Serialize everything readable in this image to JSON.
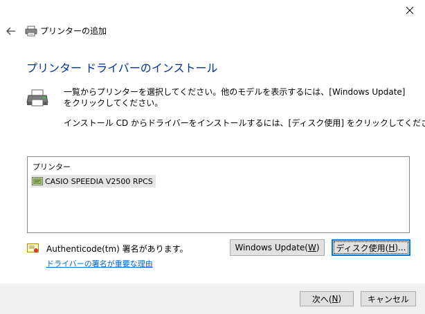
{
  "window": {
    "title": "プリンターの追加"
  },
  "heading": "プリンター ドライバーのインストール",
  "description": {
    "line1": "一覧からプリンターを選択してください。他のモデルを表示するには、[Windows Update] をクリックしてください。",
    "line2": "インストール CD からドライバーをインストールするには、[ディスク使用] をクリックしてください。"
  },
  "printer_list": {
    "header": "プリンター",
    "items": [
      {
        "label": "CASIO SPEEDIA V2500 RPCS",
        "selected": true
      }
    ]
  },
  "authenticode": {
    "text": "Authenticode(tm) 署名があります。",
    "link": "ドライバーの署名が重要な理由"
  },
  "buttons": {
    "windows_update": {
      "prefix": "Windows Update(",
      "accel": "W",
      "suffix": ")"
    },
    "disk": {
      "prefix": "ディスク使用(",
      "accel": "H",
      "suffix": ")..."
    },
    "next": {
      "prefix": "次へ(",
      "accel": "N",
      "suffix": ")"
    },
    "cancel": "キャンセル"
  },
  "icons": {
    "close": "close-icon",
    "back": "back-arrow-icon",
    "title_printer": "printer-icon",
    "large_printer": "printer-icon",
    "list_item": "printer-driver-icon",
    "certificate": "certificate-icon"
  },
  "colors": {
    "heading": "#003399",
    "link": "#0066cc",
    "focus_border": "#0078d7",
    "footer_bg": "#f0f0f0",
    "button_bg": "#e1e1e1",
    "selected_item_bg": "#e5e5e5"
  }
}
